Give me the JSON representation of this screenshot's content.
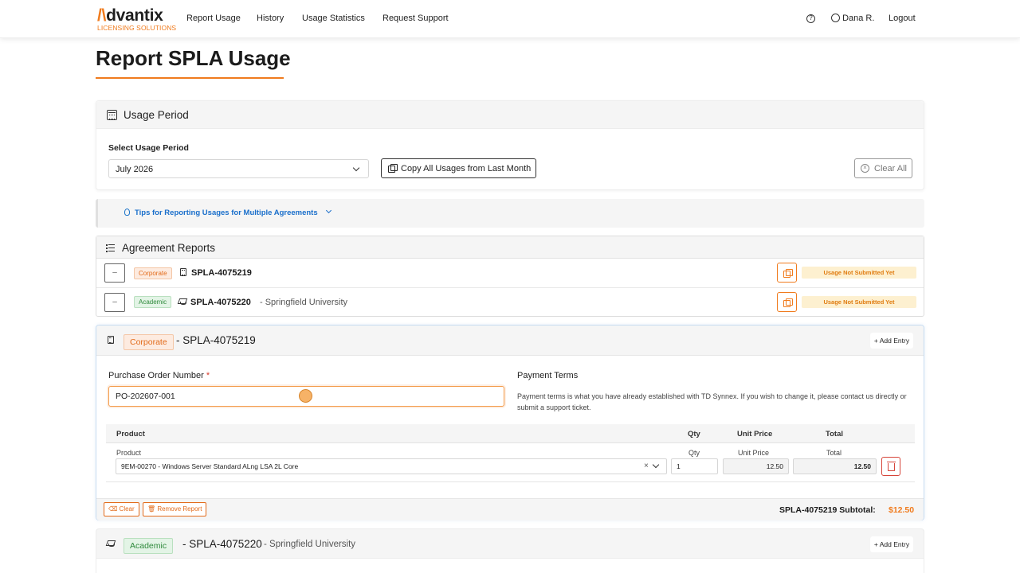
{
  "brand": {
    "name": "dvantix",
    "mark": "/\\",
    "subtitle": "LICENSING SOLUTIONS",
    "accent": "#f07b1d"
  },
  "nav": {
    "links": [
      "Report Usage",
      "History",
      "Usage Statistics",
      "Request Support"
    ],
    "help_icon": "question-circle-icon",
    "user_icon": "user-circle-icon",
    "user": "Dana R.",
    "logout": "Logout"
  },
  "page": {
    "title": "Report SPLA Usage"
  },
  "usage_period": {
    "title": "Usage Period",
    "icon": "calendar-icon",
    "label": "Select Usage Period",
    "selected": "July 2026",
    "copy_button": "Copy All Usages from Last Month",
    "clear_all_button": "Clear All"
  },
  "tips": {
    "label": "Tips for Reporting Usages for Multiple Agreements"
  },
  "agreements": {
    "title": "Agreement Reports",
    "rows": [
      {
        "collapse": "–",
        "badge": "Corporate",
        "code": "SPLA-4075219",
        "sub": "",
        "status": "Usage Not Submitted Yet"
      },
      {
        "collapse": "–",
        "badge": "Academic",
        "code": "SPLA-4075220",
        "sub": "- Springfield University",
        "status": "Usage Not Submitted Yet"
      }
    ]
  },
  "detail_corporate": {
    "badge": "Corporate",
    "code": "- SPLA-4075219",
    "add_entry": "+ Add Entry",
    "po_label": "Purchase Order Number",
    "po_required": "*",
    "po_value": "PO-202607-001",
    "payment_terms_label": "Payment Terms",
    "payment_terms_text": "Payment terms is what you have already established with TD Synnex. If you wish to change it, please contact us directly or submit a support ticket.",
    "table": {
      "headers": {
        "product": "Product",
        "qty": "Qty",
        "unit_price": "Unit Price",
        "total": "Total"
      },
      "row": {
        "product_label": "Product",
        "qty_label": "Qty",
        "unit_price_label": "Unit Price",
        "total_label": "Total",
        "product": "9EM-00270 - Windows Server Standard ALng LSA 2L Core",
        "qty": "1",
        "unit_price": "12.50",
        "total": "12.50"
      }
    },
    "clear_button": "Clear",
    "remove_button": "Remove Report",
    "subtotal_label": "SPLA-4075219 Subtotal:",
    "subtotal_value": "$12.50"
  },
  "detail_academic": {
    "badge": "Academic",
    "code": "- SPLA-4075220",
    "sub": "- Springfield University",
    "add_entry": "+ Add Entry"
  }
}
